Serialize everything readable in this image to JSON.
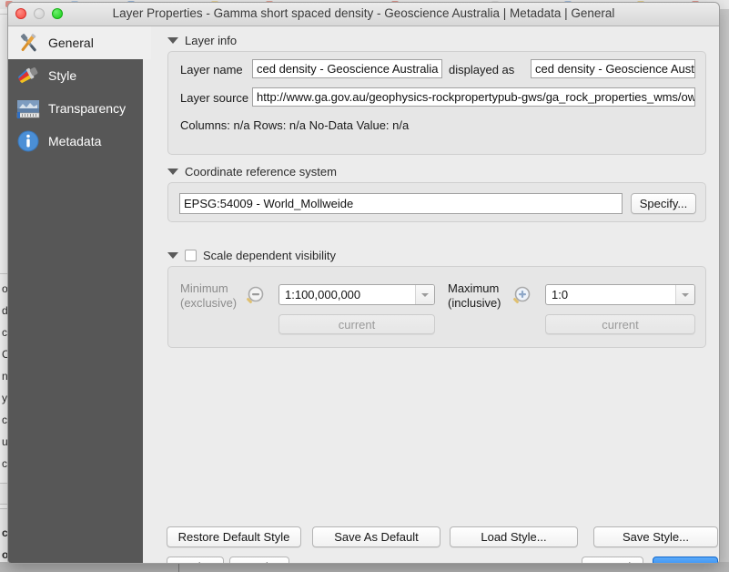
{
  "window": {
    "title": "Layer Properties - Gamma short spaced density - Geoscience Australia | Metadata | General",
    "traffic_lights": [
      "close-button",
      "minimize-button",
      "zoom-button"
    ]
  },
  "sidebar": {
    "items": [
      {
        "label": "General",
        "icon": "tools-icon",
        "selected": true
      },
      {
        "label": "Style",
        "icon": "paintbrush-icon",
        "selected": false
      },
      {
        "label": "Transparency",
        "icon": "histogram-icon",
        "selected": false
      },
      {
        "label": "Metadata",
        "icon": "info-icon",
        "selected": false
      }
    ]
  },
  "layer_info": {
    "group_title": "Layer info",
    "layer_name_label": "Layer name",
    "layer_name_value": "ced density - Geoscience Australia",
    "displayed_as_label": "displayed as",
    "displayed_as_value": "ced density - Geoscience Australia",
    "layer_source_label": "Layer source",
    "layer_source_value": "http://www.ga.gov.au/geophysics-rockpropertypub-gws/ga_rock_properties_wms/ows",
    "stats_line": "Columns: n/a   Rows: n/a   No-Data Value: n/a"
  },
  "crs": {
    "group_title": "Coordinate reference system",
    "value": "EPSG:54009 - World_Mollweide",
    "specify_label": "Specify..."
  },
  "scale_visibility": {
    "group_title": "Scale dependent visibility",
    "checked": false,
    "minimum_label": "Minimum\n(exclusive)",
    "minimum_label_line1": "Minimum",
    "minimum_label_line2": "(exclusive)",
    "minimum_value": "1:100,000,000",
    "minimum_icon": "zoom-out-icon",
    "minimum_current_label": "current",
    "maximum_label_line1": "Maximum",
    "maximum_label_line2": "(inclusive)",
    "maximum_value": "1:0",
    "maximum_icon": "zoom-in-icon",
    "maximum_current_label": "current"
  },
  "buttons": {
    "restore_default_style": "Restore Default Style",
    "save_as_default": "Save As Default",
    "load_style": "Load Style...",
    "save_style": "Save Style...",
    "help": "Help",
    "apply": "Apply",
    "cancel": "Cancel",
    "ok": "OK"
  },
  "background": {
    "fragments": [
      "os",
      "d",
      "cie",
      "C",
      "n",
      "y",
      "cie",
      "us",
      "cie",
      "o",
      "c",
      "os"
    ]
  },
  "colors": {
    "accent": "#1274ec",
    "sidebar": "#575757",
    "dialog": "#ececec",
    "group_box": "#e6e6e6"
  }
}
